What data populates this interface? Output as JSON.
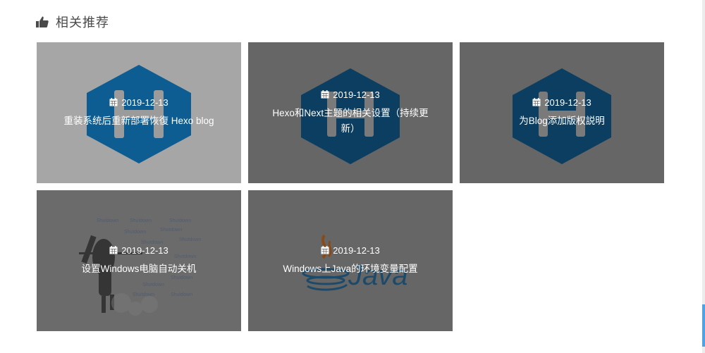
{
  "section": {
    "icon": "thumbs-up-icon",
    "title": "相关推荐"
  },
  "posts": [
    {
      "date": "2019-12-13",
      "title": "重装系统后重新部署恢復 Hexo blog",
      "image": "hexo-logo"
    },
    {
      "date": "2019-12-13",
      "title": "Hexo和Next主题的相关设置（持续更新）",
      "image": "hexo-logo"
    },
    {
      "date": "2019-12-13",
      "title": "为Blog添加版权説明",
      "image": "hexo-logo"
    },
    {
      "date": "2019-12-13",
      "title": "设置Windows电脑自动关机",
      "image": "anime-shutdown"
    },
    {
      "date": "2019-12-13",
      "title": "Windows上Java的环境变量配置",
      "image": "java-logo"
    }
  ],
  "colors": {
    "hexo_blue": "#0e83cd",
    "accent": "#4da3e6",
    "overlay": "#666666"
  }
}
